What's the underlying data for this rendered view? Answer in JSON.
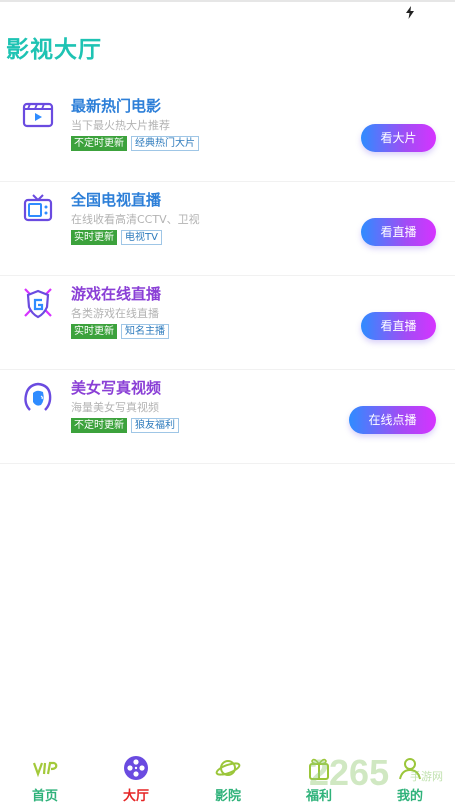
{
  "page": {
    "title": "影视大厅"
  },
  "cards": [
    {
      "title": "最新热门电影",
      "title_color": "#2d7fd8",
      "subtitle": "当下最火热大片推荐",
      "tag_solid": "不定时更新",
      "tag_outline": "经典热门大片",
      "action": "看大片",
      "icon": "film-icon"
    },
    {
      "title": "全国电视直播",
      "title_color": "#2d7fd8",
      "subtitle": "在线收看高清CCTV、卫视",
      "tag_solid": "实时更新",
      "tag_outline": "电视TV",
      "action": "看直播",
      "icon": "tv-icon"
    },
    {
      "title": "游戏在线直播",
      "title_color": "#8a3fd6",
      "subtitle": "各类游戏在线直播",
      "tag_solid": "实时更新",
      "tag_outline": "知名主播",
      "action": "看直播",
      "icon": "game-shield-icon"
    },
    {
      "title": "美女写真视频",
      "title_color": "#8a3fd6",
      "subtitle": "海量美女写真视频",
      "tag_solid": "不定时更新",
      "tag_outline": "狼友福利",
      "action": "在线点播",
      "icon": "woman-icon"
    }
  ],
  "nav": [
    {
      "label": "首页",
      "icon": "vip-icon"
    },
    {
      "label": "大厅",
      "icon": "film-reel-icon",
      "active": true
    },
    {
      "label": "影院",
      "icon": "planet-icon"
    },
    {
      "label": "福利",
      "icon": "gift-icon"
    },
    {
      "label": "我的",
      "icon": "profile-icon"
    }
  ],
  "watermark": {
    "text": "2265",
    "sub": "手游网"
  },
  "colors": {
    "accent": "#1ec3b3",
    "nav_label": "#2fb27a",
    "nav_active": "#e52525",
    "tag_green": "#3ca23c",
    "button_start": "#2f8cff",
    "button_end": "#d633ff"
  }
}
